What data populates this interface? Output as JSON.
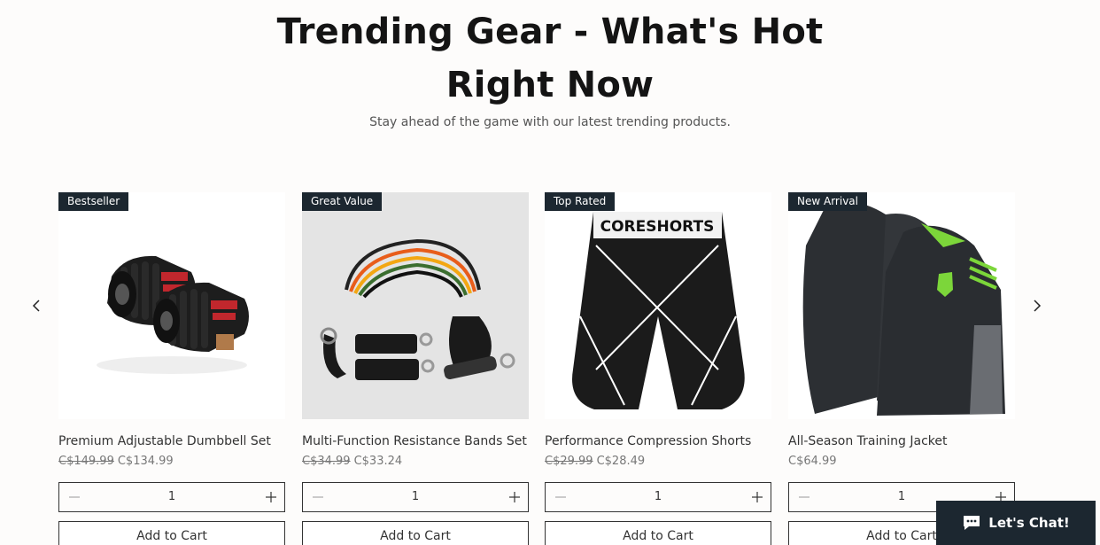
{
  "header": {
    "title_line1": "Trending Gear - What's Hot",
    "title_line2": "Right Now",
    "subtitle": "Stay ahead of the game with our latest trending products."
  },
  "carousel": {
    "prev_icon": "chevron-left-icon",
    "next_icon": "chevron-right-icon"
  },
  "products": [
    {
      "badge": "Bestseller",
      "name": "Premium Adjustable Dumbbell Set",
      "old_price": "C$149.99",
      "price": "C$134.99",
      "quantity": "1",
      "cart_label": "Add to Cart",
      "image": "dumbbell-set"
    },
    {
      "badge": "Great Value",
      "name": "Multi-Function Resistance Bands Set",
      "old_price": "C$34.99",
      "price": "C$33.24",
      "quantity": "1",
      "cart_label": "Add to Cart",
      "image": "resistance-bands"
    },
    {
      "badge": "Top Rated",
      "name": "Performance Compression Shorts",
      "old_price": "C$29.99",
      "price": "C$28.49",
      "quantity": "1",
      "cart_label": "Add to Cart",
      "image": "compression-shorts",
      "image_text": "CORESHORTS"
    },
    {
      "badge": "New Arrival",
      "name": "All-Season Training Jacket",
      "old_price": "",
      "price": "C$64.99",
      "quantity": "1",
      "cart_label": "Add to Cart",
      "image": "training-jacket"
    }
  ],
  "chat": {
    "label": "Let's Chat!",
    "icon": "chat-bubble-icon"
  },
  "colors": {
    "badge_bg": "#1c2730",
    "page_bg": "#fdfcfb",
    "accent_green": "#7cd63a"
  }
}
